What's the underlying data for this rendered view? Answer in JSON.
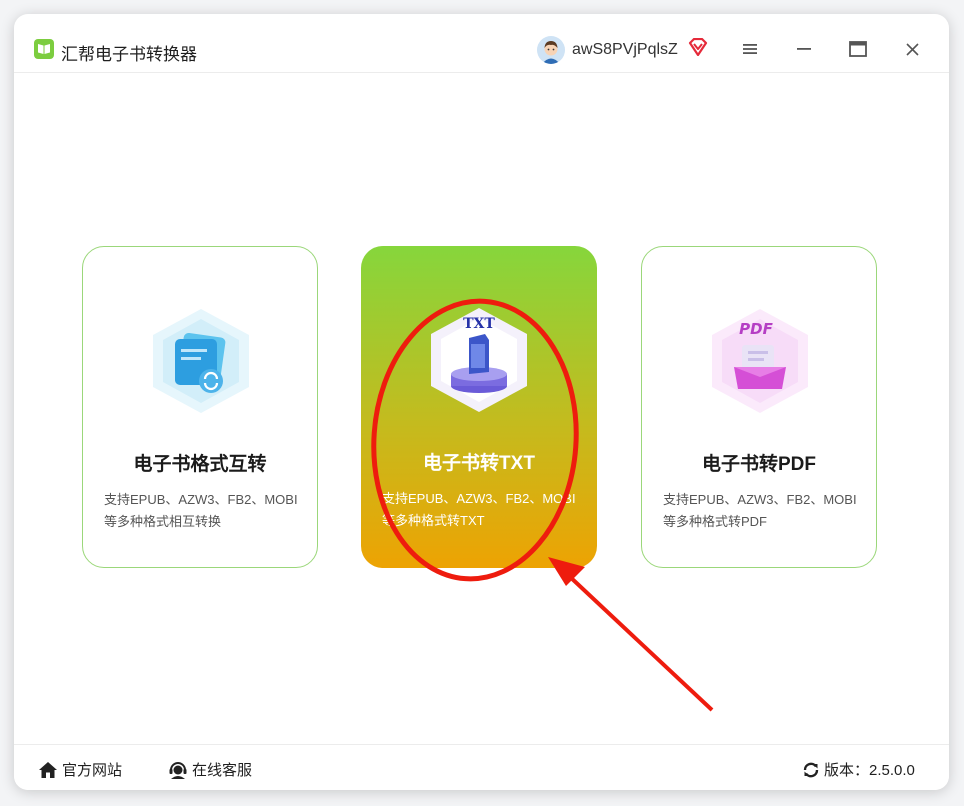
{
  "app": {
    "title": "汇帮电子书转换器",
    "username": "awS8PVjPqlsZ",
    "icons": [
      "app-logo-icon",
      "avatar",
      "vip-diamond-icon",
      "menu-icon",
      "minimize-icon",
      "maximize-icon",
      "close-icon"
    ]
  },
  "cards": [
    {
      "title": "电子书格式互转",
      "desc_line1": "支持EPUB、AZW3、FB2、MOBI",
      "desc_line2": "等多种格式相互转换",
      "icon": "ebook-convert-icon"
    },
    {
      "title": "电子书转TXT",
      "desc_line1": "支持EPUB、AZW3、FB2、MOBI",
      "desc_line2": "等多种格式转TXT",
      "icon": "txt-icon",
      "icon_label": "TXT"
    },
    {
      "title": "电子书转PDF",
      "desc_line1": "支持EPUB、AZW3、FB2、MOBI",
      "desc_line2": "等多种格式转PDF",
      "icon": "pdf-icon",
      "icon_label": "PDF"
    }
  ],
  "footer": {
    "website": "官方网站",
    "support": "在线客服",
    "version": "版本：2.5.0.0"
  },
  "colors": {
    "accent_green": "#86d63c",
    "accent_orange": "#eda303",
    "card_border": "#9bd77a",
    "annotation_red": "#ee1c0e"
  }
}
